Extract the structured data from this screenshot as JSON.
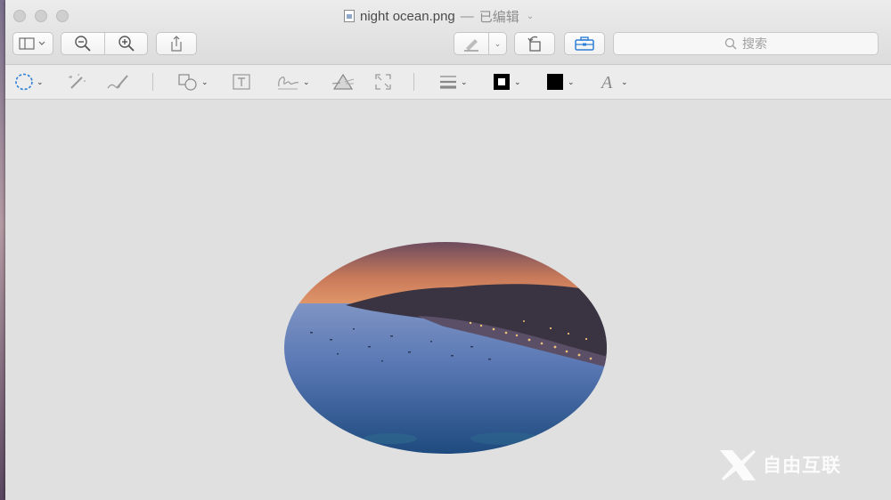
{
  "window": {
    "title": "night ocean.png",
    "title_separator": "—",
    "title_status": "已编辑"
  },
  "toolbar": {
    "search_placeholder": "搜索"
  },
  "markup": {
    "border_color": "#000000",
    "fill_color": "#000000"
  },
  "image": {
    "subject": "night ocean harbor at dusk",
    "crop_shape": "ellipse"
  },
  "watermark": {
    "text": "自由互联"
  },
  "colors": {
    "accent": "#2f7fd6",
    "window_bg": "#e0e0e0"
  }
}
